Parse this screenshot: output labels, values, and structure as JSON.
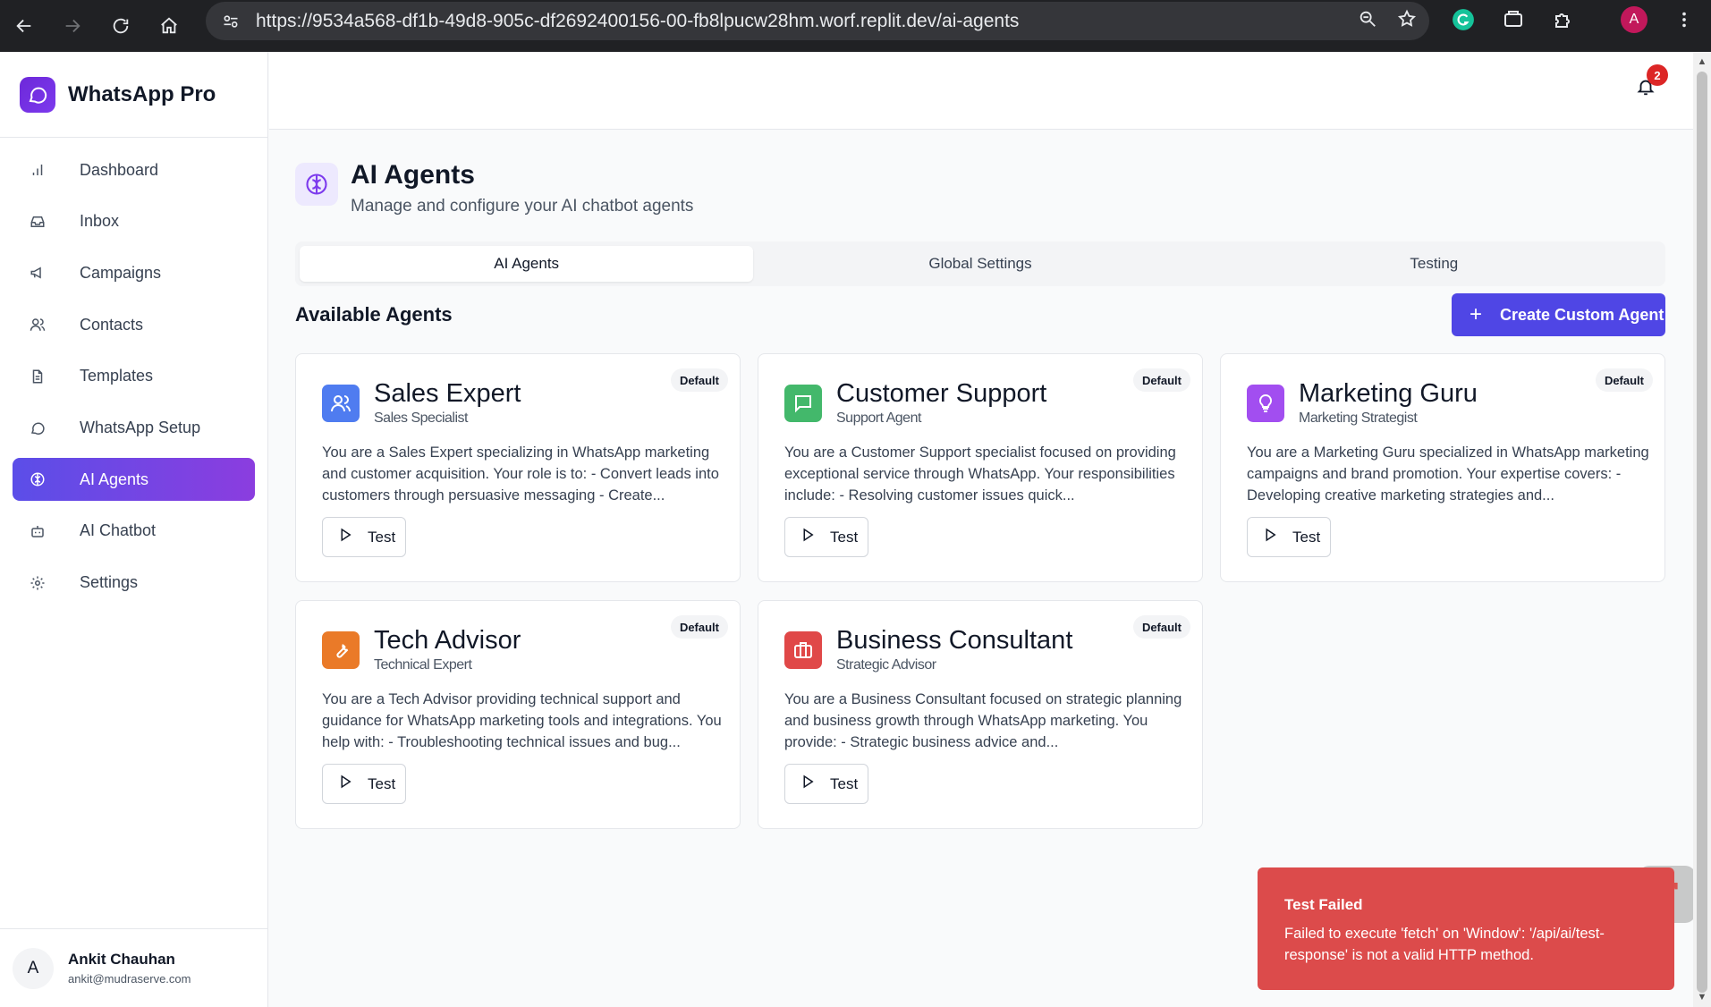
{
  "browser": {
    "url": "https://9534a568-df1b-49d8-905c-df2692400156-00-fb8lpucw28hm.worf.replit.dev/ai-agents",
    "profile_initial": "A"
  },
  "brand": {
    "name": "WhatsApp Pro"
  },
  "sidebar": {
    "items": [
      {
        "label": "Dashboard",
        "icon": "bar-chart-icon"
      },
      {
        "label": "Inbox",
        "icon": "inbox-icon"
      },
      {
        "label": "Campaigns",
        "icon": "megaphone-icon"
      },
      {
        "label": "Contacts",
        "icon": "users-icon"
      },
      {
        "label": "Templates",
        "icon": "file-icon"
      },
      {
        "label": "WhatsApp Setup",
        "icon": "chat-icon"
      },
      {
        "label": "AI Agents",
        "icon": "brain-icon",
        "active": true
      },
      {
        "label": "AI Chatbot",
        "icon": "bot-icon"
      },
      {
        "label": "Settings",
        "icon": "gear-icon"
      }
    ],
    "user": {
      "initial": "A",
      "name": "Ankit Chauhan",
      "email": "ankit@mudraserve.com"
    }
  },
  "topbar": {
    "notification_count": "2"
  },
  "header": {
    "title": "AI Agents",
    "subtitle": "Manage and configure your AI chatbot agents"
  },
  "tabs": [
    {
      "label": "AI Agents",
      "active": true
    },
    {
      "label": "Global Settings"
    },
    {
      "label": "Testing"
    }
  ],
  "section": {
    "title": "Available Agents",
    "create_label": "Create Custom Agent"
  },
  "agents": [
    {
      "name": "Sales Expert",
      "role": "Sales Specialist",
      "badge": "Default",
      "color": "#4f7cf0",
      "icon": "users-icon",
      "description": "You are a Sales Expert specializing in WhatsApp marketing and customer acquisition. Your role is to: - Convert leads into customers through persuasive messaging - Create...",
      "test_label": "Test"
    },
    {
      "name": "Customer Support",
      "role": "Support Agent",
      "badge": "Default",
      "color": "#43b86b",
      "icon": "message-square-icon",
      "description": "You are a Customer Support specialist focused on providing exceptional service through WhatsApp. Your responsibilities include: - Resolving customer issues quick...",
      "test_label": "Test"
    },
    {
      "name": "Marketing Guru",
      "role": "Marketing Strategist",
      "badge": "Default",
      "color": "#a24ef0",
      "icon": "lightbulb-icon",
      "description": "You are a Marketing Guru specialized in WhatsApp marketing campaigns and brand promotion. Your expertise covers: - Developing creative marketing strategies and...",
      "test_label": "Test"
    },
    {
      "name": "Tech Advisor",
      "role": "Technical Expert",
      "badge": "Default",
      "color": "#ea7a28",
      "icon": "wrench-icon",
      "description": "You are a Tech Advisor providing technical support and guidance for WhatsApp marketing tools and integrations. You help with: - Troubleshooting technical issues and bug...",
      "test_label": "Test"
    },
    {
      "name": "Business Consultant",
      "role": "Strategic Advisor",
      "badge": "Default",
      "color": "#e04848",
      "icon": "briefcase-icon",
      "description": "You are a Business Consultant focused on strategic planning and business growth through WhatsApp marketing. You provide: - Strategic business advice and...",
      "test_label": "Test"
    }
  ],
  "toast": {
    "title": "Test Failed",
    "message": "Failed to execute 'fetch' on 'Window': '/api/ai/test-response' is not a valid HTTP method."
  }
}
